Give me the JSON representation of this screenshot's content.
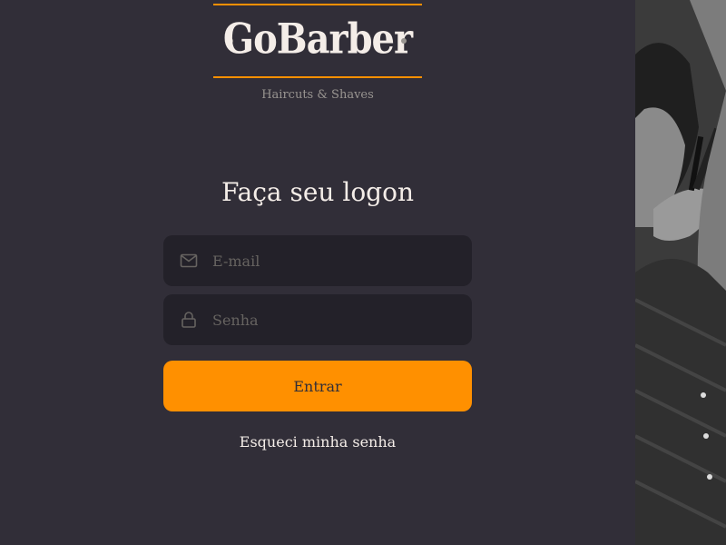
{
  "brand": {
    "name": "GoBarber",
    "tagline": "Haircuts & Shaves"
  },
  "form": {
    "title": "Faça seu logon",
    "email": {
      "placeholder": "E-mail",
      "value": "",
      "icon": "mail-icon"
    },
    "password": {
      "placeholder": "Senha",
      "value": "",
      "icon": "lock-icon"
    },
    "submit_label": "Entrar",
    "forgot_label": "Esqueci minha senha"
  },
  "colors": {
    "background": "#312e38",
    "input_background": "#232129",
    "accent": "#ff9000",
    "text": "#f4ede8",
    "muted": "#999591",
    "placeholder": "#666360"
  }
}
